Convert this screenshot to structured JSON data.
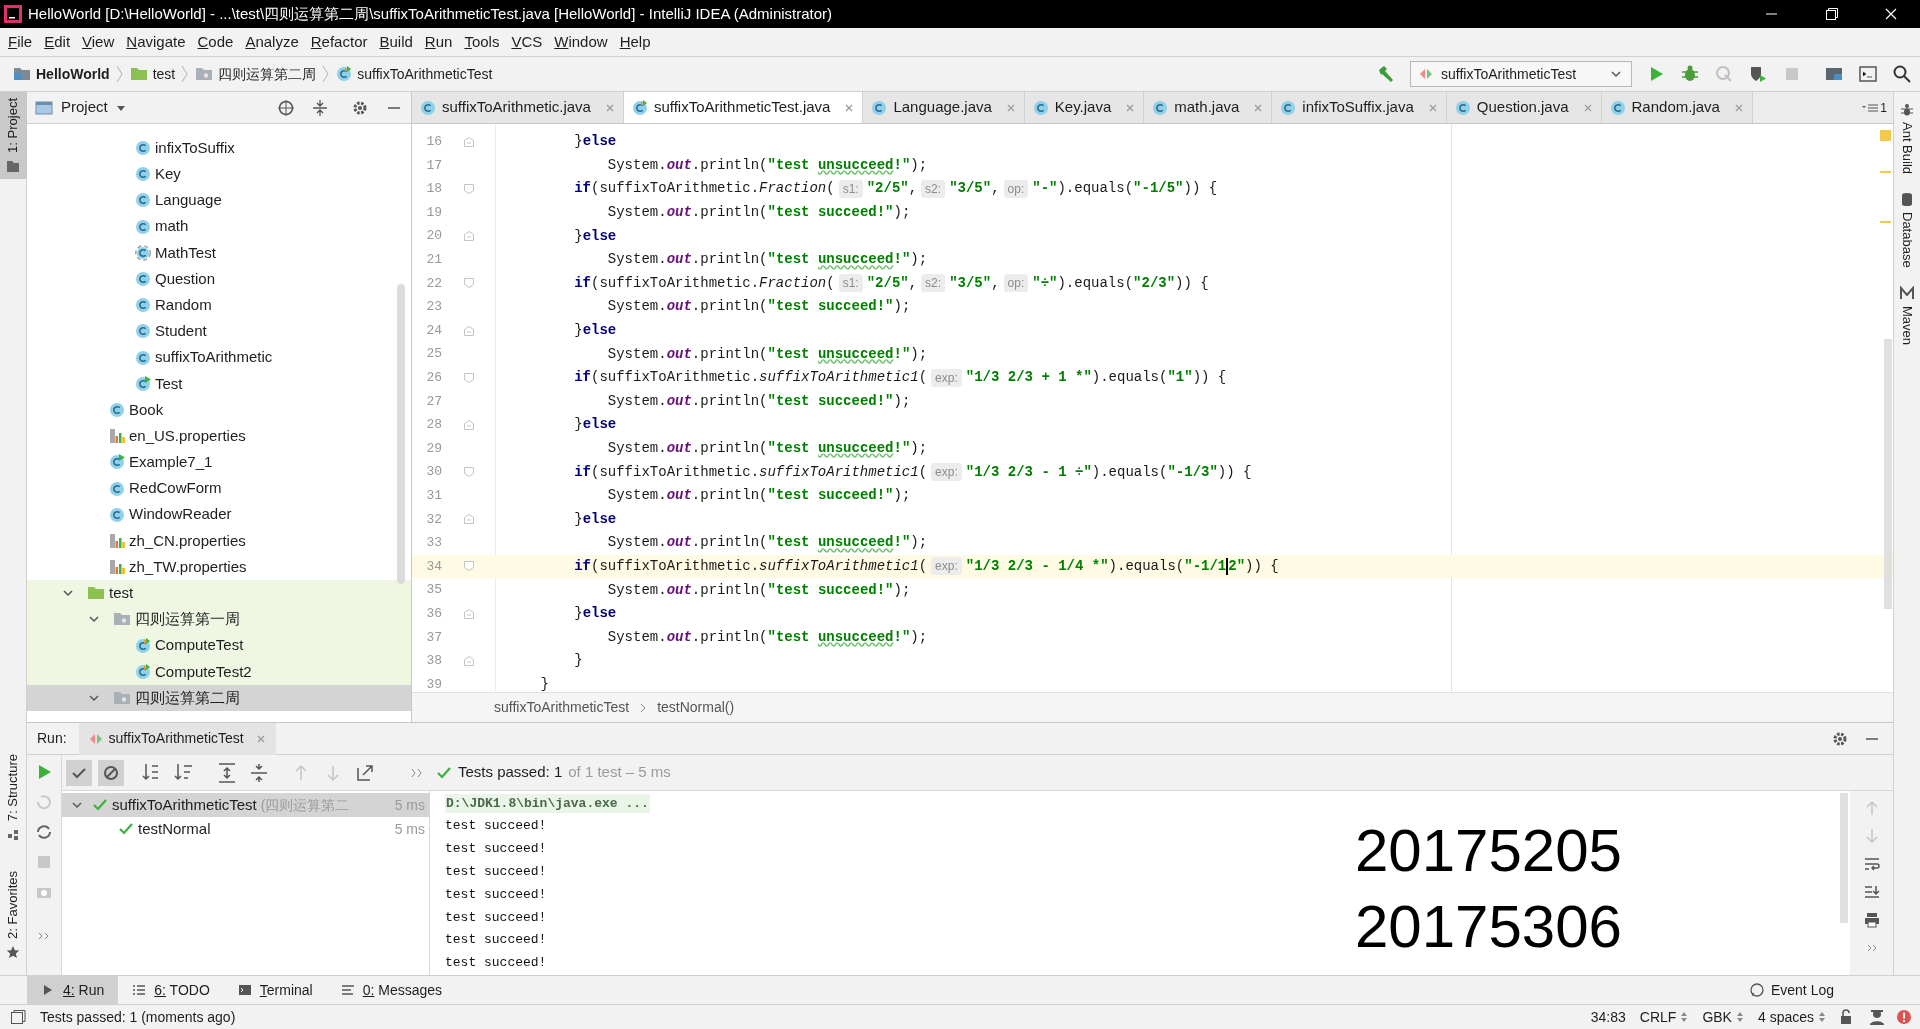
{
  "window": {
    "title": "HelloWorld [D:\\HelloWorld] - ...\\test\\四则运算第二周\\suffixToArithmeticTest.java [HelloWorld] - IntelliJ IDEA (Administrator)"
  },
  "menu": [
    "File",
    "Edit",
    "View",
    "Navigate",
    "Code",
    "Analyze",
    "Refactor",
    "Build",
    "Run",
    "Tools",
    "VCS",
    "Window",
    "Help"
  ],
  "breadcrumbs": [
    {
      "label": "HelloWorld",
      "kind": "project"
    },
    {
      "label": "test",
      "kind": "folder"
    },
    {
      "label": "四则运算第二周",
      "kind": "package"
    },
    {
      "label": "suffixToArithmeticTest",
      "kind": "test-class"
    }
  ],
  "run_config": "suffixToArithmeticTest",
  "left_strip": {
    "top": [
      {
        "label": "1: Project",
        "selected": true
      }
    ],
    "bottom": [
      {
        "label": "7: Structure",
        "selected": false
      },
      {
        "label": "2: Favorites",
        "selected": false
      }
    ]
  },
  "right_strip": [
    "Ant Build",
    "Database",
    "Maven"
  ],
  "project": {
    "title": "Project",
    "items": [
      {
        "kind": "source",
        "children": [
          {
            "kind": "source",
            "children": [
              {
                "label": "infixToSuffix",
                "kind": "class",
                "selected": false
              },
              {
                "label": "Key",
                "kind": "class",
                "selected": false
              },
              {
                "label": "Language",
                "kind": "class",
                "selected": false
              },
              {
                "label": "math",
                "kind": "class",
                "selected": false
              },
              {
                "label": "MathTest",
                "kind": "class-dashed",
                "selected": false
              },
              {
                "label": "Question",
                "kind": "class",
                "selected": false
              },
              {
                "label": "Random",
                "kind": "class",
                "selected": false
              },
              {
                "label": "Student",
                "kind": "class",
                "selected": false
              },
              {
                "label": "suffixToArithmetic",
                "kind": "class",
                "selected": false
              },
              {
                "label": "Test",
                "kind": "class-run",
                "selected": false
              }
            ]
          },
          {
            "label": "Book",
            "kind": "class",
            "selected": false
          },
          {
            "label": "en_US.properties",
            "kind": "properties",
            "selected": false
          },
          {
            "label": "Example7_1",
            "kind": "class-run",
            "selected": false
          },
          {
            "label": "RedCowForm",
            "kind": "class",
            "selected": false
          },
          {
            "label": "WindowReader",
            "kind": "class",
            "selected": false
          },
          {
            "label": "zh_CN.properties",
            "kind": "properties",
            "selected": false
          },
          {
            "label": "zh_TW.properties",
            "kind": "properties",
            "selected": false
          }
        ]
      },
      {
        "label": "test",
        "kind": "test-root",
        "expanded": true,
        "selected": false,
        "children": [
          {
            "label": "四则运算第一周",
            "kind": "package",
            "expanded": true,
            "selected": false,
            "children": [
              {
                "label": "ComputeTest",
                "kind": "test-class",
                "selected": false
              },
              {
                "label": "ComputeTest2",
                "kind": "test-class",
                "selected": false
              }
            ]
          },
          {
            "label": "四则运算第二周",
            "kind": "package",
            "expanded": true,
            "selected": true
          }
        ]
      }
    ]
  },
  "tabs": [
    {
      "label": "suffixToArithmetic.java",
      "kind": "class",
      "selected": false
    },
    {
      "label": "suffixToArithmeticTest.java",
      "kind": "test-class",
      "selected": true
    },
    {
      "label": "Language.java",
      "kind": "class",
      "selected": false
    },
    {
      "label": "Key.java",
      "kind": "class",
      "selected": false
    },
    {
      "label": "math.java",
      "kind": "class",
      "selected": false
    },
    {
      "label": "infixToSuffix.java",
      "kind": "class",
      "selected": false
    },
    {
      "label": "Question.java",
      "kind": "class",
      "selected": false
    },
    {
      "label": "Random.java",
      "kind": "class",
      "selected": false
    }
  ],
  "tab_count": "1",
  "code": {
    "lines": [
      {
        "number": "16",
        "fold_end": true,
        "current": false,
        "segments": [
          {
            "kind": "plain",
            "text": "        }"
          },
          {
            "kind": "keyword",
            "text": "else"
          }
        ]
      },
      {
        "number": "17",
        "current": false,
        "segments": [
          {
            "kind": "plain",
            "text": "            System."
          },
          {
            "kind": "static",
            "text": "out"
          },
          {
            "kind": "plain",
            "text": ".println("
          },
          {
            "kind": "string",
            "text": "\"test "
          },
          {
            "kind": "typo",
            "text": "unsucceed"
          },
          {
            "kind": "string",
            "text": "!\""
          },
          {
            "kind": "plain",
            "text": ");"
          }
        ]
      },
      {
        "number": "18",
        "fold_start": true,
        "current": false,
        "segments": [
          {
            "kind": "keyword",
            "text": "        if"
          },
          {
            "kind": "plain",
            "text": "(suffixToArithmetic."
          },
          {
            "kind": "italic",
            "text": "Fraction"
          },
          {
            "kind": "plain",
            "text": "("
          },
          {
            "kind": "hint",
            "text": "s1:"
          },
          {
            "kind": "string",
            "text": "\"2/5\""
          },
          {
            "kind": "plain",
            "text": ","
          },
          {
            "kind": "hint",
            "text": "s2:"
          },
          {
            "kind": "string",
            "text": "\"3/5\""
          },
          {
            "kind": "plain",
            "text": ","
          },
          {
            "kind": "hint",
            "text": "op:"
          },
          {
            "kind": "string",
            "text": "\"-\""
          },
          {
            "kind": "plain",
            "text": ").equals("
          },
          {
            "kind": "string",
            "text": "\"-1/5\""
          },
          {
            "kind": "plain",
            "text": ")) {"
          }
        ]
      },
      {
        "number": "19",
        "current": false,
        "segments": [
          {
            "kind": "plain",
            "text": "            System."
          },
          {
            "kind": "static",
            "text": "out"
          },
          {
            "kind": "plain",
            "text": ".println("
          },
          {
            "kind": "string",
            "text": "\"test succeed!\""
          },
          {
            "kind": "plain",
            "text": ");"
          }
        ]
      },
      {
        "number": "20",
        "fold_end": true,
        "current": false,
        "segments": [
          {
            "kind": "plain",
            "text": "        }"
          },
          {
            "kind": "keyword",
            "text": "else"
          }
        ]
      },
      {
        "number": "21",
        "current": false,
        "segments": [
          {
            "kind": "plain",
            "text": "            System."
          },
          {
            "kind": "static",
            "text": "out"
          },
          {
            "kind": "plain",
            "text": ".println("
          },
          {
            "kind": "string",
            "text": "\"test "
          },
          {
            "kind": "typo",
            "text": "unsucceed"
          },
          {
            "kind": "string",
            "text": "!\""
          },
          {
            "kind": "plain",
            "text": ");"
          }
        ]
      },
      {
        "number": "22",
        "fold_start": true,
        "current": false,
        "segments": [
          {
            "kind": "keyword",
            "text": "        if"
          },
          {
            "kind": "plain",
            "text": "(suffixToArithmetic."
          },
          {
            "kind": "italic",
            "text": "Fraction"
          },
          {
            "kind": "plain",
            "text": "("
          },
          {
            "kind": "hint",
            "text": "s1:"
          },
          {
            "kind": "string",
            "text": "\"2/5\""
          },
          {
            "kind": "plain",
            "text": ","
          },
          {
            "kind": "hint",
            "text": "s2:"
          },
          {
            "kind": "string",
            "text": "\"3/5\""
          },
          {
            "kind": "plain",
            "text": ","
          },
          {
            "kind": "hint",
            "text": "op:"
          },
          {
            "kind": "string",
            "text": "\"÷\""
          },
          {
            "kind": "plain",
            "text": ").equals("
          },
          {
            "kind": "string",
            "text": "\"2/3\""
          },
          {
            "kind": "plain",
            "text": ")) {"
          }
        ]
      },
      {
        "number": "23",
        "current": false,
        "segments": [
          {
            "kind": "plain",
            "text": "            System."
          },
          {
            "kind": "static",
            "text": "out"
          },
          {
            "kind": "plain",
            "text": ".println("
          },
          {
            "kind": "string",
            "text": "\"test succeed!\""
          },
          {
            "kind": "plain",
            "text": ");"
          }
        ]
      },
      {
        "number": "24",
        "fold_end": true,
        "current": false,
        "segments": [
          {
            "kind": "plain",
            "text": "        }"
          },
          {
            "kind": "keyword",
            "text": "else"
          }
        ]
      },
      {
        "number": "25",
        "current": false,
        "segments": [
          {
            "kind": "plain",
            "text": "            System."
          },
          {
            "kind": "static",
            "text": "out"
          },
          {
            "kind": "plain",
            "text": ".println("
          },
          {
            "kind": "string",
            "text": "\"test "
          },
          {
            "kind": "typo",
            "text": "unsucceed"
          },
          {
            "kind": "string",
            "text": "!\""
          },
          {
            "kind": "plain",
            "text": ");"
          }
        ]
      },
      {
        "number": "26",
        "fold_start": true,
        "current": false,
        "segments": [
          {
            "kind": "keyword",
            "text": "        if"
          },
          {
            "kind": "plain",
            "text": "(suffixToArithmetic."
          },
          {
            "kind": "italic",
            "text": "suffixToArithmetic1"
          },
          {
            "kind": "plain",
            "text": "("
          },
          {
            "kind": "hint",
            "text": "exp:"
          },
          {
            "kind": "string",
            "text": "\"1/3 2/3 + 1 *\""
          },
          {
            "kind": "plain",
            "text": ").equals("
          },
          {
            "kind": "string",
            "text": "\"1\""
          },
          {
            "kind": "plain",
            "text": ")) {"
          }
        ]
      },
      {
        "number": "27",
        "current": false,
        "segments": [
          {
            "kind": "plain",
            "text": "            System."
          },
          {
            "kind": "static",
            "text": "out"
          },
          {
            "kind": "plain",
            "text": ".println("
          },
          {
            "kind": "string",
            "text": "\"test succeed!\""
          },
          {
            "kind": "plain",
            "text": ");"
          }
        ]
      },
      {
        "number": "28",
        "fold_end": true,
        "current": false,
        "segments": [
          {
            "kind": "plain",
            "text": "        }"
          },
          {
            "kind": "keyword",
            "text": "else"
          }
        ]
      },
      {
        "number": "29",
        "current": false,
        "segments": [
          {
            "kind": "plain",
            "text": "            System."
          },
          {
            "kind": "static",
            "text": "out"
          },
          {
            "kind": "plain",
            "text": ".println("
          },
          {
            "kind": "string",
            "text": "\"test "
          },
          {
            "kind": "typo",
            "text": "unsucceed"
          },
          {
            "kind": "string",
            "text": "!\""
          },
          {
            "kind": "plain",
            "text": ");"
          }
        ]
      },
      {
        "number": "30",
        "fold_start": true,
        "current": false,
        "segments": [
          {
            "kind": "keyword",
            "text": "        if"
          },
          {
            "kind": "plain",
            "text": "(suffixToArithmetic."
          },
          {
            "kind": "italic",
            "text": "suffixToArithmetic1"
          },
          {
            "kind": "plain",
            "text": "("
          },
          {
            "kind": "hint",
            "text": "exp:"
          },
          {
            "kind": "string",
            "text": "\"1/3 2/3 - 1 ÷\""
          },
          {
            "kind": "plain",
            "text": ").equals("
          },
          {
            "kind": "string",
            "text": "\"-1/3\""
          },
          {
            "kind": "plain",
            "text": ")) {"
          }
        ]
      },
      {
        "number": "31",
        "current": false,
        "segments": [
          {
            "kind": "plain",
            "text": "            System."
          },
          {
            "kind": "static",
            "text": "out"
          },
          {
            "kind": "plain",
            "text": ".println("
          },
          {
            "kind": "string",
            "text": "\"test succeed!\""
          },
          {
            "kind": "plain",
            "text": ");"
          }
        ]
      },
      {
        "number": "32",
        "fold_end": true,
        "current": false,
        "segments": [
          {
            "kind": "plain",
            "text": "        }"
          },
          {
            "kind": "keyword",
            "text": "else"
          }
        ]
      },
      {
        "number": "33",
        "current": false,
        "segments": [
          {
            "kind": "plain",
            "text": "            System."
          },
          {
            "kind": "static",
            "text": "out"
          },
          {
            "kind": "plain",
            "text": ".println("
          },
          {
            "kind": "string",
            "text": "\"test "
          },
          {
            "kind": "typo",
            "text": "unsucceed"
          },
          {
            "kind": "string",
            "text": "!\""
          },
          {
            "kind": "plain",
            "text": ");"
          }
        ]
      },
      {
        "number": "34",
        "fold_start": true,
        "current": true,
        "segments": [
          {
            "kind": "keyword",
            "text": "        if"
          },
          {
            "kind": "plain",
            "text": "(suffixToArithmetic."
          },
          {
            "kind": "italic",
            "text": "suffixToArithmetic1"
          },
          {
            "kind": "plain",
            "text": "("
          },
          {
            "kind": "hint",
            "text": "exp:"
          },
          {
            "kind": "string",
            "text": "\"1/3 2/3 - 1/4 *\""
          },
          {
            "kind": "plain",
            "text": ").equals("
          },
          {
            "kind": "string",
            "text": "\"-1/1"
          },
          {
            "kind": "caret"
          },
          {
            "kind": "string",
            "text": "2\""
          },
          {
            "kind": "plain",
            "text": ")) {"
          }
        ]
      },
      {
        "number": "35",
        "current": false,
        "segments": [
          {
            "kind": "plain",
            "text": "            System."
          },
          {
            "kind": "static",
            "text": "out"
          },
          {
            "kind": "plain",
            "text": ".println("
          },
          {
            "kind": "string",
            "text": "\"test succeed!\""
          },
          {
            "kind": "plain",
            "text": ");"
          }
        ]
      },
      {
        "number": "36",
        "fold_end": true,
        "current": false,
        "segments": [
          {
            "kind": "plain",
            "text": "        }"
          },
          {
            "kind": "keyword",
            "text": "else"
          }
        ]
      },
      {
        "number": "37",
        "current": false,
        "segments": [
          {
            "kind": "plain",
            "text": "            System."
          },
          {
            "kind": "static",
            "text": "out"
          },
          {
            "kind": "plain",
            "text": ".println("
          },
          {
            "kind": "string",
            "text": "\"test "
          },
          {
            "kind": "typo",
            "text": "unsucceed"
          },
          {
            "kind": "string",
            "text": "!\""
          },
          {
            "kind": "plain",
            "text": ");"
          }
        ]
      },
      {
        "number": "38",
        "fold_end": true,
        "current": false,
        "segments": [
          {
            "kind": "plain",
            "text": "        }"
          }
        ]
      },
      {
        "number": "39",
        "current": false,
        "segments": [
          {
            "kind": "plain",
            "text": "    }"
          }
        ]
      }
    ]
  },
  "editor_breadcrumbs": [
    "suffixToArithmeticTest",
    "testNormal()"
  ],
  "run": {
    "title": "Run:",
    "tab": "suffixToArithmeticTest",
    "show_passed": true,
    "show_ignored": true,
    "status": "Tests passed: 1",
    "status_detail": "of 1 test – 5 ms",
    "tests": [
      {
        "label": "suffixToArithmeticTest",
        "note": "(四则运算第二",
        "time": "5 ms",
        "passed": true,
        "selected": true,
        "expanded": true,
        "children": [
          {
            "label": "testNormal",
            "time": "5 ms",
            "passed": true,
            "selected": false
          }
        ]
      }
    ],
    "console": [
      {
        "kind": "command",
        "text": "D:\\JDK1.8\\bin\\java.exe ..."
      },
      {
        "kind": "output",
        "text": "test succeed!"
      },
      {
        "kind": "output",
        "text": "test succeed!"
      },
      {
        "kind": "output",
        "text": "test succeed!"
      },
      {
        "kind": "output",
        "text": "test succeed!"
      },
      {
        "kind": "output",
        "text": "test succeed!"
      },
      {
        "kind": "output",
        "text": "test succeed!"
      },
      {
        "kind": "output",
        "text": "test succeed!"
      }
    ],
    "overlay_numbers": [
      "20175205",
      "20175306"
    ]
  },
  "bottom_tabs": [
    {
      "label": "4: Run",
      "kind": "run",
      "selected": true
    },
    {
      "label": "6: TODO",
      "kind": "todo",
      "selected": false
    },
    {
      "label": "Terminal",
      "kind": "terminal",
      "selected": false
    },
    {
      "label": "0: Messages",
      "kind": "messages",
      "selected": false
    }
  ],
  "event_log": "Event Log",
  "status_bar": {
    "message": "Tests passed: 1 (moments ago)",
    "items": [
      "34:83",
      "CRLF",
      "GBK",
      "4 spaces"
    ]
  }
}
